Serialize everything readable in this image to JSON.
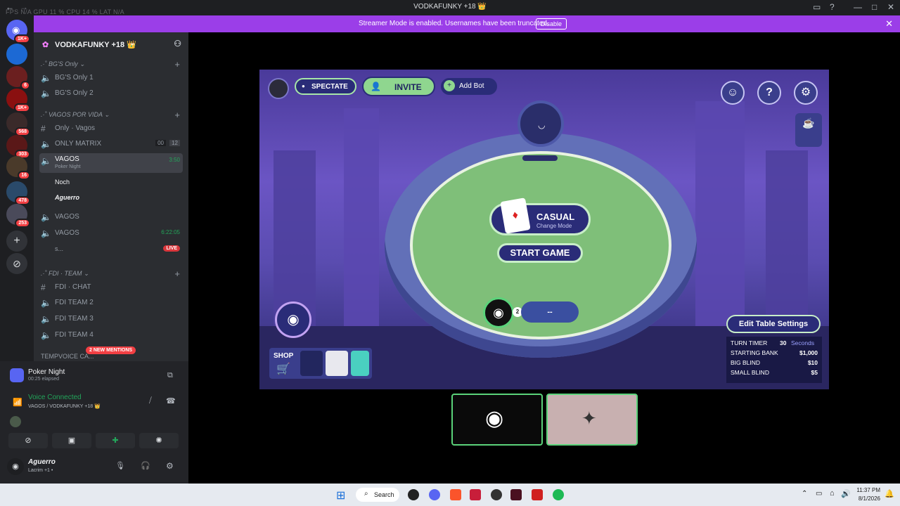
{
  "window": {
    "title": "VODKAFUNKY +18 👑",
    "stats": "FPS  N/A     GPU  11 %     CPU  14 %     LAT  N/A"
  },
  "banner": {
    "message": "Streamer Mode is enabled. Usernames have been truncated.",
    "button": "Disable"
  },
  "rail": {
    "badges": [
      "1K+",
      "6",
      "1K+",
      "568",
      "303",
      "16",
      "478",
      "253"
    ]
  },
  "server": {
    "name": "VODKAFUNKY +18 👑"
  },
  "categories": [
    {
      "name": "BG'S Only"
    },
    {
      "name": "VAGOS POR VIDA"
    },
    {
      "name": "FDI · TEAM"
    },
    {
      "name": "TEMPVOICE CA..."
    }
  ],
  "channels": {
    "bg1": "BG'S Only 1",
    "bg2": "BG'S Only 2",
    "only_vagos": "Only · Vagos",
    "only_matrix": "ONLY MATRIX",
    "matrix_c1": "00",
    "matrix_c2": "12",
    "vagos_active": "VAGOS",
    "vagos_time": "3:50",
    "vagos_activity": "Poker Night",
    "user1": "Noch",
    "user2": "Aguerro",
    "vagos2": "VAGOS",
    "vagos3": "VAGOS",
    "vagos3_time": "6:22:05",
    "stream_user": "s...",
    "live": "LIVE",
    "fdi_chat": "FDI · CHAT",
    "fdi2": "FDI TEAM 2",
    "fdi3": "FDI TEAM 3",
    "fdi4": "FDI TEAM 4",
    "mentions": "2 NEW MENTIONS"
  },
  "activity": {
    "name": "Poker Night",
    "elapsed": "00:25 elapsed"
  },
  "voice": {
    "status": "Voice Connected",
    "location": "VAGOS / VODKAFUNKY +18 👑"
  },
  "user": {
    "name": "Aguerro",
    "status": "Lacrim +1 •"
  },
  "game": {
    "spectate": "SPECTATE",
    "invite": "INVITE",
    "add_bot": "Add Bot",
    "mode": "CASUAL",
    "mode_sub": "Change Mode",
    "start": "START GAME",
    "seat_count": "2",
    "seat_name": "--",
    "shop": "SHOP",
    "edit_settings": "Edit Table Settings",
    "settings": [
      {
        "label": "TURN TIMER",
        "value": "30",
        "unit": "Seconds"
      },
      {
        "label": "STARTING BANK",
        "value": "$1,000"
      },
      {
        "label": "BIG BLIND",
        "value": "$10"
      },
      {
        "label": "SMALL BLIND",
        "value": "$5"
      }
    ]
  },
  "taskbar": {
    "search": "Search",
    "time": "11:37 PM",
    "date": "8/1/2026"
  },
  "colors": {
    "accent": "#9b3ee8",
    "green": "#23a55a",
    "table": "#7fbf79",
    "danger": "#f23f43"
  }
}
